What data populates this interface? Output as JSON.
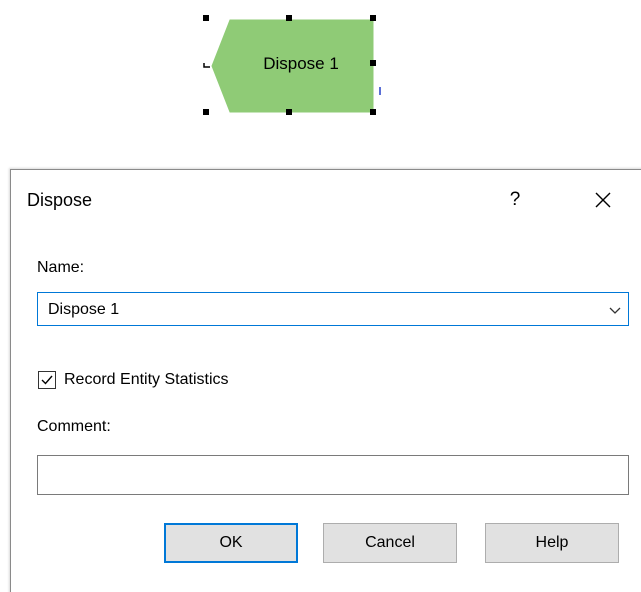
{
  "module": {
    "label": "Dispose 1",
    "fill_color": "#8fcb76"
  },
  "dialog": {
    "title": "Dispose",
    "help_glyph": "?",
    "close_glyph": "close-icon",
    "name_label": "Name:",
    "name_value": "Dispose 1",
    "record_stats_label": "Record Entity Statistics",
    "record_stats_checked": true,
    "comment_label": "Comment:",
    "comment_value": "",
    "buttons": {
      "ok": "OK",
      "cancel": "Cancel",
      "help": "Help"
    },
    "accent_color": "#0078d7",
    "button_bg": "#e1e1e1"
  }
}
